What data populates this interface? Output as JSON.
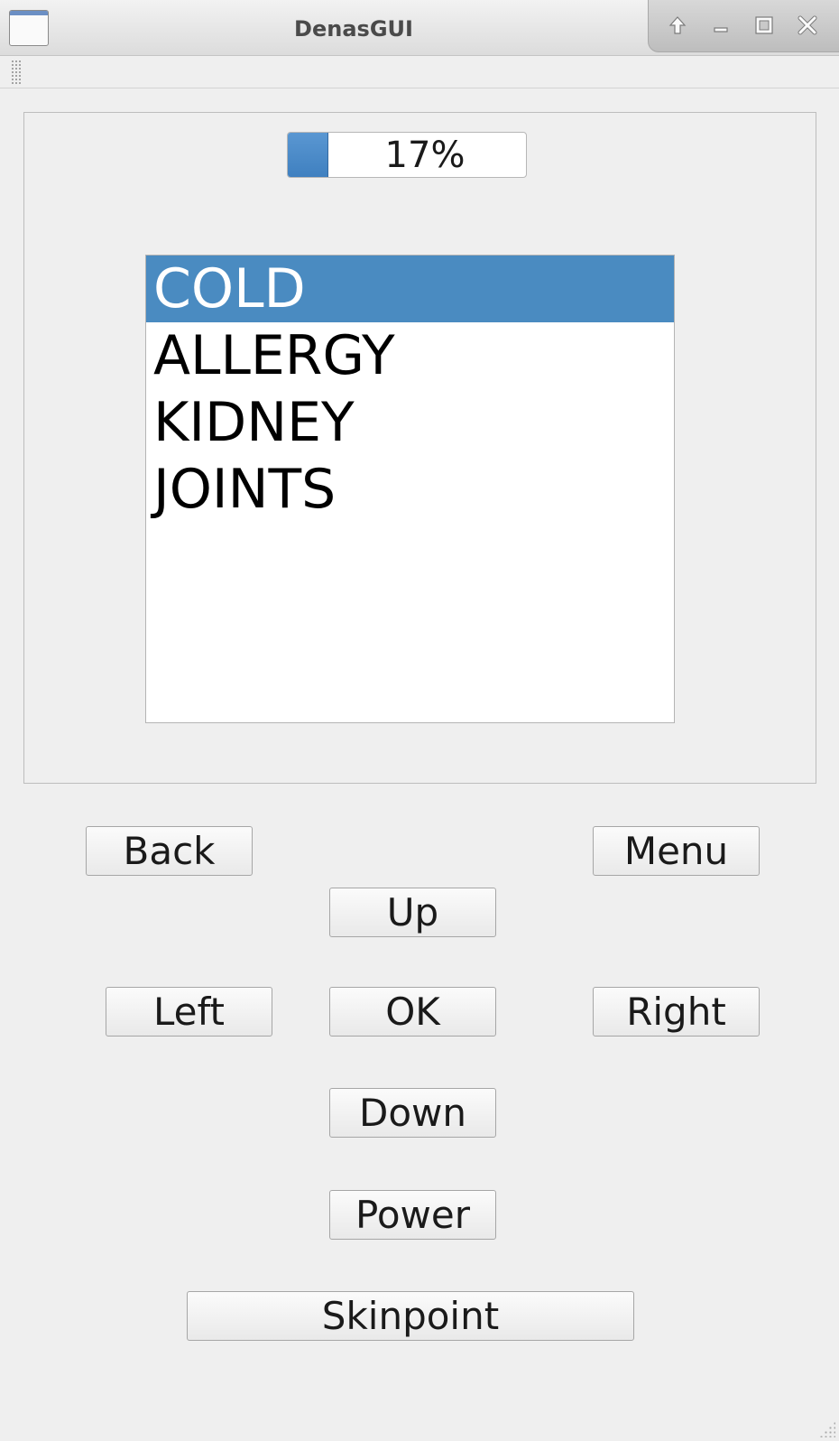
{
  "window": {
    "title": "DenasGUI",
    "title_icons": [
      "keep-above-icon",
      "minimize-icon",
      "maximize-icon",
      "close-icon"
    ]
  },
  "progress": {
    "value": 17,
    "text": "17%",
    "fill_color": "#4a8bc8"
  },
  "list": {
    "items": [
      "COLD",
      "ALLERGY",
      "KIDNEY",
      "JOINTS"
    ],
    "selected_index": 0,
    "selected_color": "#4a8bc1"
  },
  "buttons": {
    "back": "Back",
    "menu": "Menu",
    "up": "Up",
    "left": "Left",
    "ok": "OK",
    "right": "Right",
    "down": "Down",
    "power": "Power",
    "skinpoint": "Skinpoint"
  }
}
